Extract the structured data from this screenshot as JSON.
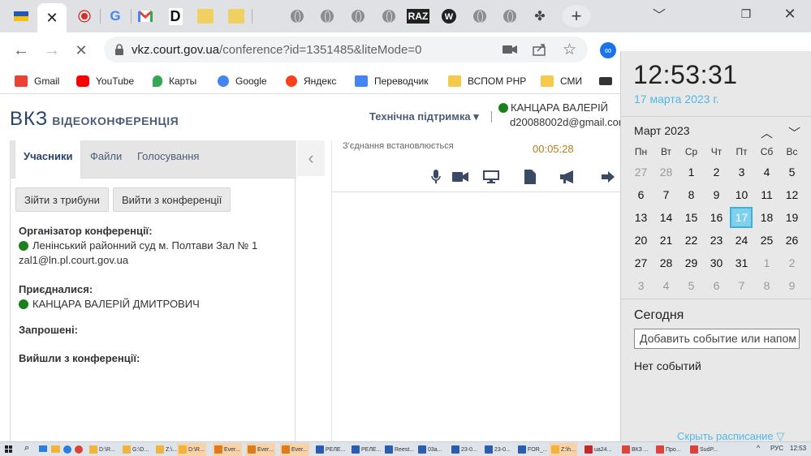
{
  "browser": {
    "tab_labels": {
      "raz": "RAZ"
    },
    "new_tab": "+",
    "url_host": "vkz.court.gov.ua",
    "url_path": "/conference?id=1351485&liteMode=0",
    "bookmarks": [
      {
        "label": "Gmail",
        "color": "#ea4335"
      },
      {
        "label": "YouTube",
        "color": "#ff0000"
      },
      {
        "label": "Карты",
        "color": "#34a853"
      },
      {
        "label": "Google",
        "color": "#4285f4"
      },
      {
        "label": "Яндекс",
        "color": "#fc3f1d"
      },
      {
        "label": "Переводчик",
        "color": "#4285f4"
      },
      {
        "label": "ВСПОМ РНР",
        "color": "#f6c94a"
      },
      {
        "label": "СМИ",
        "color": "#f6c94a"
      }
    ]
  },
  "page": {
    "brand_big": "ВКЗ",
    "brand_small": "ВІДЕОКОНФЕРЕНЦІЯ",
    "support": "Технічна підтримка ▾",
    "user_name": "КАНЦАРА ВАЛЕРІЙ",
    "user_email": "d20088002d@gmail.com",
    "tabs": [
      "Учасники",
      "Файли",
      "Голосування"
    ],
    "buttons": {
      "leave_tribune": "Зійти з трибуни",
      "leave_conference": "Вийти з конференції"
    },
    "organizer_title": "Організатор конференції:",
    "organizer_name": "Ленінський районний суд м. Полтави Зал № 1",
    "organizer_email": "zal1@ln.pl.court.gov.ua",
    "joined_title": "Приєдналися:",
    "joined_name": "КАНЦАРА ВАЛЕРІЙ ДМИТРОВИЧ",
    "invited_title": "Запрошені:",
    "left_title": "Вийшли з конференції:",
    "status": "З'єднання встановлюється",
    "timer": "00:05:28"
  },
  "calendar": {
    "time": "12:53:31",
    "date": "17 марта 2023 г.",
    "month": "Март 2023",
    "weekdays": [
      "Пн",
      "Вт",
      "Ср",
      "Чт",
      "Пт",
      "Сб",
      "Вс"
    ],
    "weeks": [
      [
        "27",
        "28",
        "1",
        "2",
        "3",
        "4",
        "5"
      ],
      [
        "6",
        "7",
        "8",
        "9",
        "10",
        "11",
        "12"
      ],
      [
        "13",
        "14",
        "15",
        "16",
        "17",
        "18",
        "19"
      ],
      [
        "20",
        "21",
        "22",
        "23",
        "24",
        "25",
        "26"
      ],
      [
        "27",
        "28",
        "29",
        "30",
        "31",
        "1",
        "2"
      ],
      [
        "3",
        "4",
        "5",
        "6",
        "7",
        "8",
        "9"
      ]
    ],
    "today_label": "Сегодня",
    "event_placeholder": "Добавить событие или напом",
    "no_events": "Нет событий",
    "hide_link": "Скрыть расписание ▽"
  },
  "taskbar": {
    "items": [
      "D:\\R...",
      "G:\\D...",
      "Z:\\...",
      "D:\\R...",
      "Ever...",
      "Ever...",
      "Ever...",
      "РЕЛЕ...",
      "РЕЛЕ...",
      "Reest...",
      "03a...",
      "23-0...",
      "23-0...",
      "FOR_...",
      "Z:\\h...",
      "ua24...",
      "ВКЗ ...",
      "Про...",
      "SudP..."
    ],
    "lang": "РУС",
    "clock": "12:53"
  }
}
